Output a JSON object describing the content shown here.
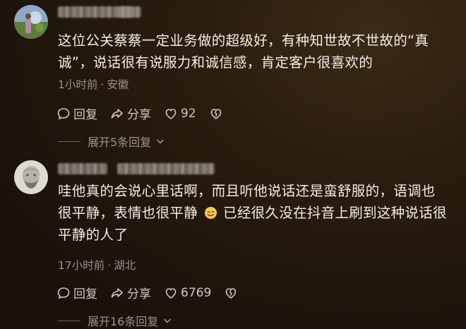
{
  "comments": [
    {
      "text_line1": "这位公关蔡蔡一定业务做的超级好，有种知世故不世故的“真",
      "text_line2": "诚”，说话很有说服力和诚信感，肯定客户很喜欢的",
      "time": "1小时前",
      "location": "安徽",
      "reply_label": "回复",
      "share_label": "分享",
      "likes": "92",
      "expand_label": "展开5条回复"
    },
    {
      "text_line1": "哇他真的会说心里话啊，而且听他说话还是蛮舒服的，语调也",
      "text_line2a": "很平静，表情也很平静",
      "text_line2b": "已经很久没在抖音上刷到这种说话很",
      "text_line3": "平静的人了",
      "time": "17小时前",
      "location": "湖北",
      "reply_label": "回复",
      "share_label": "分享",
      "likes": "6769",
      "expand_label": "展开16条回复"
    }
  ],
  "meta_separator": "·",
  "icons": [
    "comment-bubble-icon",
    "share-arrow-icon",
    "heart-icon",
    "broken-heart-icon",
    "chevron-down-icon",
    "smile-emoji-icon"
  ]
}
